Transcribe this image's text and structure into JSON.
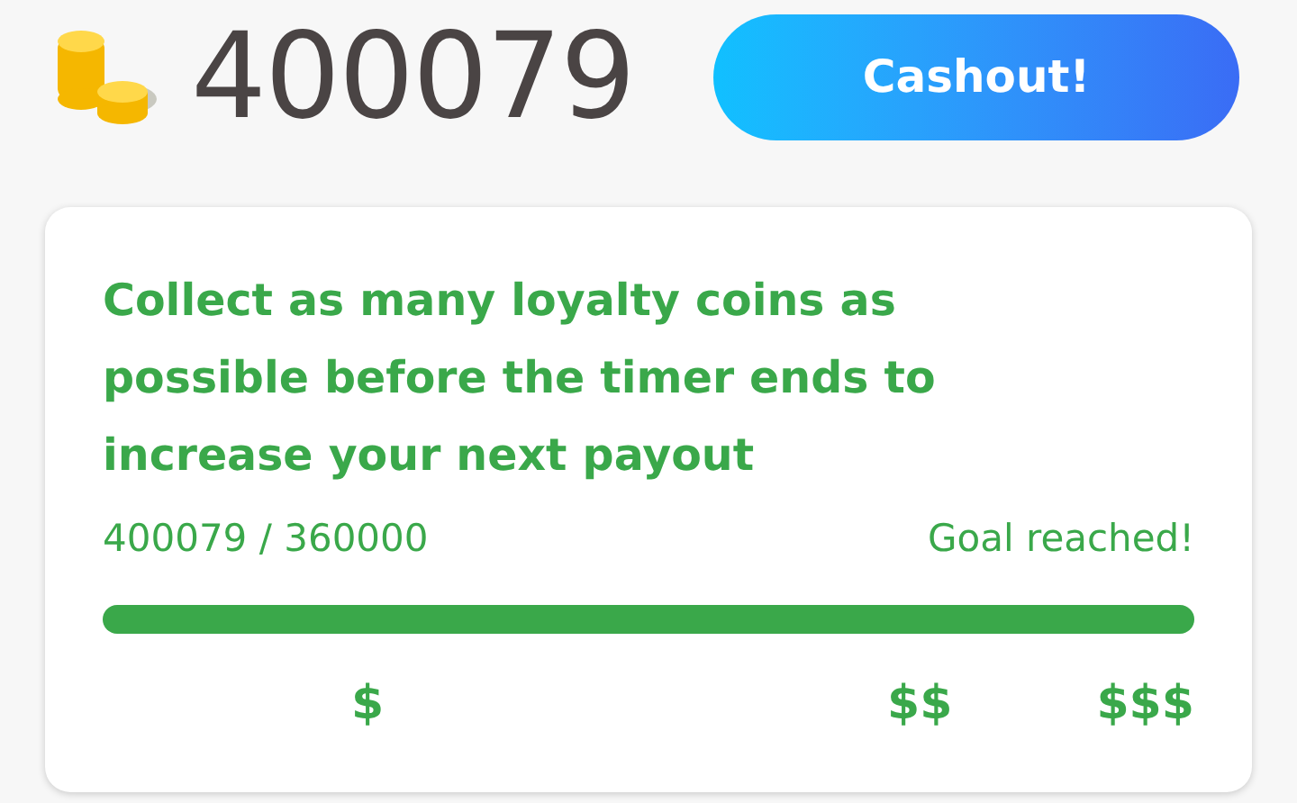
{
  "balance": "400079",
  "cashout_button": "Cashout!",
  "card": {
    "message": "Collect as many loyalty coins as possible before the timer ends to increase your next payout",
    "progress_text": "400079 / 360000",
    "status": "Goal reached!",
    "tiers": [
      "$",
      "$$",
      "$$$"
    ]
  }
}
